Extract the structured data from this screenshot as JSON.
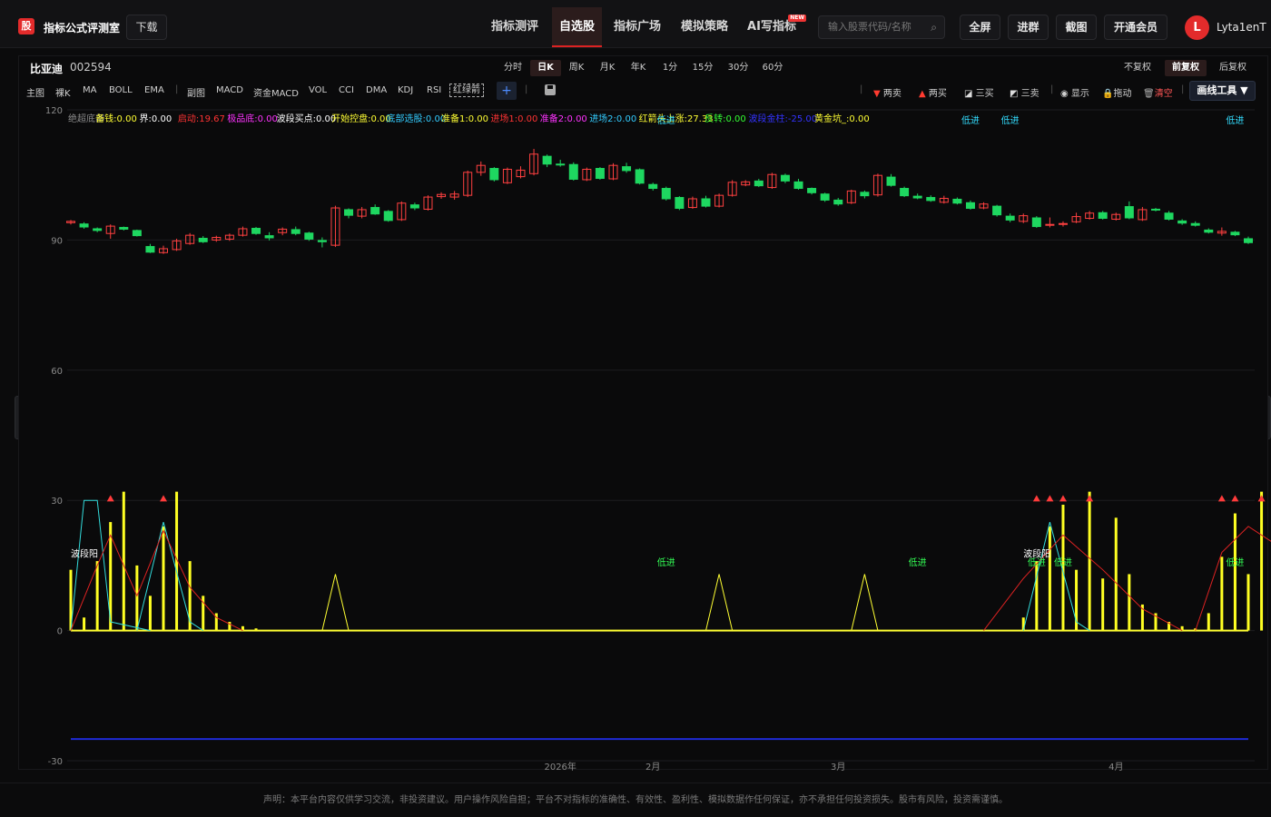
{
  "header": {
    "logo": "股",
    "brand": "指标公式评测室",
    "download": "下载",
    "nav": [
      {
        "label": "指标测评"
      },
      {
        "label": "自选股"
      },
      {
        "label": "指标广场"
      },
      {
        "label": "模拟策略"
      },
      {
        "label": "AI写指标"
      }
    ],
    "new_badge": "NEW",
    "search_placeholder": "输入股票代码/名称",
    "buttons": {
      "fullscreen": "全屏",
      "join_group": "进群",
      "screenshot": "截图",
      "vip": "开通会员"
    },
    "avatar_letter": "L",
    "username": "Lyta1enT"
  },
  "stock": {
    "name": "比亚迪",
    "code": "002594"
  },
  "periods": [
    "分时",
    "日K",
    "周K",
    "月K",
    "年K",
    "1分",
    "15分",
    "30分",
    "60分"
  ],
  "active_period": "日K",
  "rights": [
    "不复权",
    "前复权",
    "后复权"
  ],
  "indicator_tabs": [
    "主图",
    "裸K",
    "MA",
    "BOLL",
    "EMA",
    "副图",
    "MACD",
    "资金MACD",
    "VOL",
    "CCI",
    "DMA",
    "KDJ",
    "RSI",
    "红绿箭"
  ],
  "right_tools": {
    "two_sell": "两卖",
    "two_buy": "两买",
    "three_buy": "三买",
    "three_sell": "三卖",
    "show": "显示",
    "drag": "拖动",
    "clear": "清空",
    "draw_tools": "画线工具 ▼"
  },
  "legend": [
    {
      "text": "绝超底部",
      "color": "#8a8a8a"
    },
    {
      "text": "备钱:0.00",
      "color": "#ffff33"
    },
    {
      "text": "界:0.00",
      "color": "#ffffff"
    },
    {
      "text": "启动:19.67",
      "color": "#ff3333"
    },
    {
      "text": "极品底:0.00",
      "color": "#ff33ff"
    },
    {
      "text": "波段买点:0.00",
      "color": "#ffffff"
    },
    {
      "text": "开始控盘:0.00",
      "color": "#ffff33"
    },
    {
      "text": "底部选股:0.00",
      "color": "#33ccff"
    },
    {
      "text": "准备1:0.00",
      "color": "#ffff33"
    },
    {
      "text": "进场1:0.00",
      "color": "#ff3333"
    },
    {
      "text": "准备2:0.00",
      "color": "#ff33ff"
    },
    {
      "text": "进场2:0.00",
      "color": "#33ccff"
    },
    {
      "text": "红箭头上涨:27.33",
      "color": "#ffff33"
    },
    {
      "text": "反转:0.00",
      "color": "#33ff33"
    },
    {
      "text": "波段金柱:-25.00",
      "color": "#3333ff"
    },
    {
      "text": "黄金坑_:0.00",
      "color": "#ffff33"
    }
  ],
  "chart_labels": {
    "low_entry": "低进",
    "wave_yang": "波段阳",
    "x_ticks": [
      "2026年",
      "2月",
      "3月",
      "4月"
    ]
  },
  "chart_data": {
    "type": "candlestick",
    "y_ticks": [
      120,
      90,
      60,
      30,
      0,
      -30
    ],
    "ylim": [
      -30,
      120
    ],
    "candles": [
      [
        94,
        94.3,
        93.6,
        94.6
      ],
      [
        93.7,
        93,
        92.6,
        94.1
      ],
      [
        92.6,
        92.2,
        91.8,
        92.9
      ],
      [
        91.5,
        93.2,
        90.3,
        93.6
      ],
      [
        92.9,
        92.5,
        92.2,
        93.1
      ],
      [
        92.2,
        91,
        90.8,
        92.4
      ],
      [
        88.5,
        87.2,
        87,
        89.1
      ],
      [
        87.1,
        88,
        86.8,
        88.7
      ],
      [
        87.8,
        89.8,
        87.5,
        90.3
      ],
      [
        89.2,
        91.1,
        88.9,
        91.6
      ],
      [
        90.4,
        89.6,
        89.3,
        90.9
      ],
      [
        90,
        90.6,
        89.6,
        91
      ],
      [
        90.2,
        91.1,
        89.8,
        91.5
      ],
      [
        91.1,
        92.6,
        90.8,
        93.1
      ],
      [
        92.7,
        91.5,
        91.2,
        93
      ],
      [
        91,
        90.5,
        89.9,
        91.8
      ],
      [
        91.7,
        92.5,
        91.1,
        92.9
      ],
      [
        92.4,
        91.5,
        91.1,
        93.1
      ],
      [
        91.6,
        90.2,
        89.8,
        91.9
      ],
      [
        89.9,
        89.6,
        88.3,
        90.6
      ],
      [
        88.8,
        97.4,
        88.4,
        97.9
      ],
      [
        97,
        95.7,
        95,
        97.3
      ],
      [
        95.5,
        97,
        95,
        97.6
      ],
      [
        97.5,
        96,
        95.8,
        98.2
      ],
      [
        96.6,
        94.5,
        94.2,
        96.9
      ],
      [
        94.7,
        98.5,
        94.4,
        98.9
      ],
      [
        98.1,
        97.4,
        96.9,
        98.6
      ],
      [
        97.1,
        99.9,
        96.8,
        100.3
      ],
      [
        100,
        100.5,
        99.5,
        101
      ],
      [
        99.9,
        100.6,
        99.3,
        101.3
      ],
      [
        100.3,
        105.6,
        99.9,
        106
      ],
      [
        105.6,
        107.2,
        104.8,
        108.1
      ],
      [
        106.5,
        103.9,
        103.5,
        106.8
      ],
      [
        103.2,
        106.3,
        102.9,
        106.7
      ],
      [
        104.6,
        106.1,
        104.2,
        107
      ],
      [
        105.3,
        109.8,
        104.9,
        111
      ],
      [
        109.3,
        107.5,
        106.8,
        109.7
      ],
      [
        107.5,
        107.4,
        106.9,
        108.5
      ],
      [
        107.4,
        104,
        103.7,
        107.9
      ],
      [
        103.9,
        106.3,
        103.6,
        106.7
      ],
      [
        106.5,
        104.2,
        103.9,
        106.8
      ],
      [
        104.1,
        107.2,
        103.8,
        107.7
      ],
      [
        106.9,
        106,
        105.5,
        107.8
      ],
      [
        106.2,
        103.1,
        102.8,
        106.5
      ],
      [
        102.8,
        101.9,
        101.4,
        103.2
      ],
      [
        101.9,
        99.5,
        99.1,
        102.3
      ],
      [
        99.8,
        97.3,
        96.9,
        100.1
      ],
      [
        97.5,
        99.5,
        97.2,
        100
      ],
      [
        99.5,
        97.8,
        97.5,
        100.2
      ],
      [
        97.8,
        100.3,
        97.5,
        100.7
      ],
      [
        100.3,
        103.3,
        100,
        103.8
      ],
      [
        102.7,
        103.4,
        102.4,
        103.8
      ],
      [
        103.6,
        102.5,
        102.2,
        104.1
      ],
      [
        102.1,
        105.1,
        101.8,
        105.5
      ],
      [
        104.9,
        103.6,
        103.1,
        105.3
      ],
      [
        103.4,
        101.9,
        101.6,
        104.1
      ],
      [
        101.9,
        100.9,
        100.5,
        102.1
      ],
      [
        100.6,
        99.2,
        98.8,
        100.9
      ],
      [
        99.2,
        98.3,
        97.9,
        99.7
      ],
      [
        98.6,
        101.3,
        98.3,
        101.6
      ],
      [
        101,
        100.2,
        99.6,
        101.4
      ],
      [
        100.4,
        104.9,
        100,
        105.3
      ],
      [
        104.5,
        102.6,
        102.3,
        105.2
      ],
      [
        101.9,
        100.2,
        99.9,
        102.3
      ],
      [
        100.1,
        99.7,
        99.4,
        100.7
      ],
      [
        99.8,
        99.1,
        98.8,
        100.3
      ],
      [
        98.7,
        99.6,
        98.4,
        100.2
      ],
      [
        99.4,
        98.5,
        98.2,
        99.8
      ],
      [
        98.6,
        97.3,
        97,
        99.1
      ],
      [
        97.4,
        98.3,
        97.1,
        98.7
      ],
      [
        97.8,
        95.8,
        95.4,
        98.1
      ],
      [
        95.5,
        94.6,
        94.1,
        96.1
      ],
      [
        94.3,
        95.6,
        93.9,
        96.1
      ],
      [
        95.1,
        93.1,
        92.8,
        95.5
      ],
      [
        93.6,
        93.6,
        92.9,
        95.2
      ],
      [
        93.6,
        93.8,
        93.1,
        94.3
      ],
      [
        94.2,
        95.4,
        93.9,
        96.3
      ],
      [
        95,
        96.2,
        94.7,
        96.7
      ],
      [
        96.3,
        95,
        94.7,
        96.7
      ],
      [
        94.8,
        95.9,
        94.5,
        96.3
      ],
      [
        97.7,
        95.1,
        94.8,
        98.9
      ],
      [
        94.7,
        97,
        94.4,
        97.6
      ],
      [
        97.1,
        96.9,
        96.6,
        97.4
      ],
      [
        96.2,
        94.8,
        94.5,
        96.7
      ],
      [
        94.4,
        93.9,
        93.5,
        94.8
      ],
      [
        93.8,
        93.4,
        93.1,
        94.3
      ],
      [
        92.3,
        91.8,
        91.5,
        92.7
      ],
      [
        91.6,
        92,
        91,
        92.9
      ],
      [
        91.8,
        91.2,
        90.9,
        92.1
      ],
      [
        90.3,
        89.4,
        89.1,
        90.8
      ]
    ],
    "osc": {
      "yellow_bars": [
        [
          0,
          14
        ],
        [
          1,
          3
        ],
        [
          2,
          16
        ],
        [
          3,
          25
        ],
        [
          4,
          32
        ],
        [
          5,
          15
        ],
        [
          6,
          8
        ],
        [
          7,
          24
        ],
        [
          8,
          32
        ],
        [
          9,
          16
        ],
        [
          10,
          8
        ],
        [
          11,
          4
        ],
        [
          12,
          2
        ],
        [
          13,
          1
        ],
        [
          14,
          0.5
        ],
        [
          72,
          3
        ],
        [
          73,
          16
        ],
        [
          74,
          24
        ],
        [
          75,
          29
        ],
        [
          76,
          14
        ],
        [
          77,
          32
        ],
        [
          78,
          12
        ],
        [
          79,
          26
        ],
        [
          80,
          13
        ],
        [
          81,
          6
        ],
        [
          82,
          4
        ],
        [
          83,
          2
        ],
        [
          84,
          1
        ],
        [
          85,
          0.5
        ],
        [
          86,
          4
        ],
        [
          87,
          17
        ],
        [
          88,
          27
        ],
        [
          89,
          13
        ],
        [
          90,
          32
        ],
        [
          91,
          16
        ]
      ],
      "arrows_up_red": [
        3,
        7,
        73,
        74,
        75,
        77,
        87,
        88,
        90
      ],
      "triangle_peaks": [
        20,
        49,
        60
      ],
      "low_entry_idx": [
        45,
        64,
        73,
        75,
        88
      ]
    }
  }
}
